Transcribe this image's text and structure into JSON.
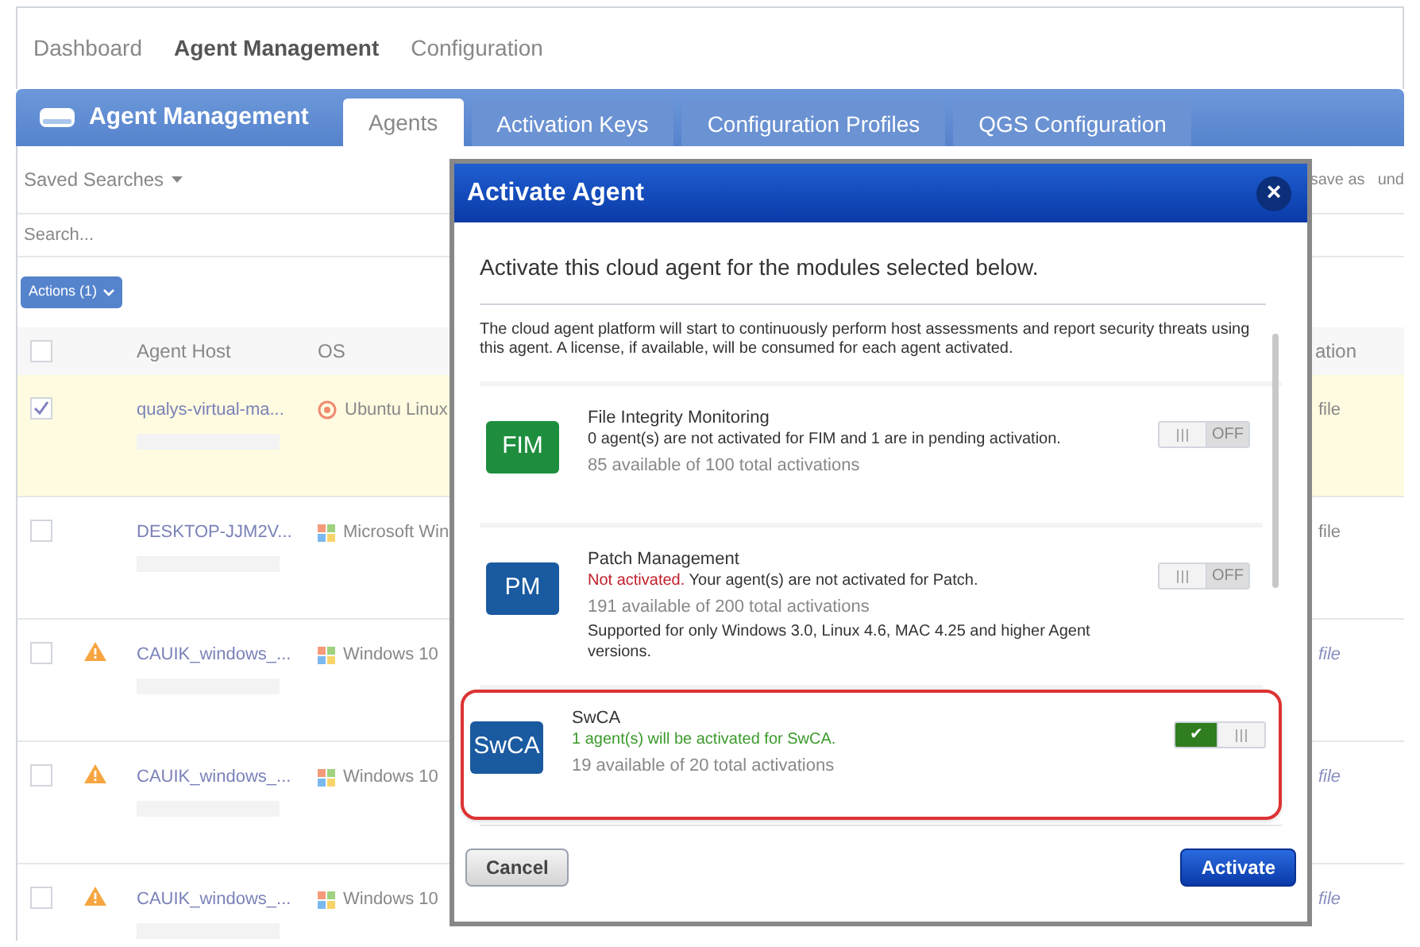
{
  "nav": [
    {
      "label": "Dashboard",
      "selected": false
    },
    {
      "label": "Agent Management",
      "selected": true
    },
    {
      "label": "Configuration",
      "selected": false
    }
  ],
  "header": {
    "title": "Agent Management"
  },
  "tabs": [
    {
      "label": "Agents",
      "selected": true
    },
    {
      "label": "Activation Keys",
      "selected": false
    },
    {
      "label": "Configuration Profiles",
      "selected": false
    },
    {
      "label": "QGS Configuration",
      "selected": false
    }
  ],
  "saved_searches": "Saved Searches",
  "search": {
    "placeholder": "Search..."
  },
  "search_links": [
    "save as",
    "und"
  ],
  "actions_button": "Actions (1)",
  "table": {
    "columns": [
      "Agent Host",
      "OS",
      "ation"
    ],
    "all_checked": false,
    "rows": [
      {
        "checked": true,
        "warning": false,
        "host": "qualys-virtual-ma...",
        "kind": "linux",
        "os": "Ubuntu Linux",
        "column_3": "file",
        "selected": true
      },
      {
        "checked": false,
        "warning": false,
        "host": "DESKTOP-JJM2V...",
        "kind": "windows",
        "os": "Microsoft Win",
        "column_3": "file",
        "selected": false
      },
      {
        "checked": false,
        "warning": true,
        "host": "CAUIK_windows_...",
        "kind": "windows",
        "os": "Windows 10",
        "column_3": "file",
        "selected": false
      },
      {
        "checked": false,
        "warning": true,
        "host": "CAUIK_windows_...",
        "kind": "windows",
        "os": "Windows 10",
        "column_3": "file",
        "selected": false
      },
      {
        "checked": false,
        "warning": true,
        "host": "CAUIK_windows_...",
        "kind": "windows",
        "os": "Windows 10",
        "column_3": "file",
        "selected": false
      }
    ]
  },
  "dialog": {
    "title": "Activate Agent",
    "close": "×",
    "intro": "Activate this cloud agent for the modules selected below.",
    "description": "The cloud agent platform will start to continuously perform host assessments and report security threats using this agent. A license, if available, will be consumed for each agent activated.",
    "modules": [
      {
        "badge": "FIM",
        "color": "#1e8e3e",
        "name": "File Integrity Monitoring",
        "kind": "neutral",
        "status": "0 agent(s) are not activated for FIM and 1 are in pending activation.",
        "availability": "85 available of 100 total activations",
        "toggle_label": "OFF",
        "on": false,
        "highlighted": false
      },
      {
        "badge": "PM",
        "color": "#1a5aa0",
        "name": "Patch Management",
        "kind": "error",
        "status_prefix": "Not activated.",
        "status": "Your agent(s) are not activated for Patch.",
        "availability": "191 available of 200 total activations",
        "note": "Supported for only Windows 3.0, Linux 4.6, MAC 4.25 and higher Agent versions.",
        "toggle_label": "OFF",
        "on": false,
        "highlighted": false
      },
      {
        "badge": "SwCA",
        "color": "#1a5aa0",
        "name": "SwCA",
        "kind": "success",
        "status": "1 agent(s) will be activated for SwCA.",
        "availability": "19 available of 20 total activations",
        "toggle_label": "✔",
        "on": true,
        "highlighted": true
      }
    ],
    "buttons": [
      {
        "label": "Cancel",
        "kind": "secondary"
      },
      {
        "label": "Activate",
        "kind": "primary"
      }
    ]
  }
}
